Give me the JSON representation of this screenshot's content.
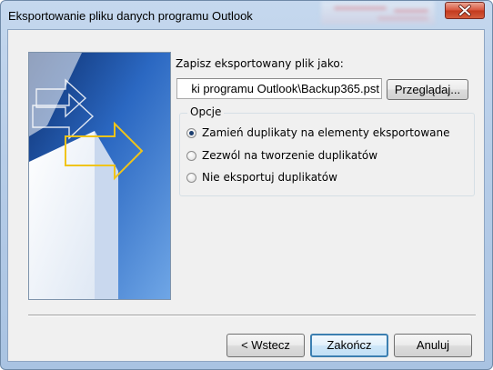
{
  "window": {
    "title": "Eksportowanie pliku danych programu Outlook",
    "close_icon": "close-icon"
  },
  "form": {
    "save_as_label": "Zapisz eksportowany plik jako:",
    "path_value": "ki programu Outlook\\Backup365.pst",
    "browse_label": "Przeglądaj..."
  },
  "options": {
    "group_title": "Opcje",
    "items": [
      {
        "label": "Zamień duplikaty na elementy eksportowane",
        "checked": true
      },
      {
        "label": "Zezwól na tworzenie duplikatów",
        "checked": false
      },
      {
        "label": "Nie eksportuj duplikatów",
        "checked": false
      }
    ]
  },
  "buttons": {
    "back": "< Wstecz",
    "finish": "Zakończ",
    "cancel": "Anuluj"
  },
  "colors": {
    "title_bar": "#b7cde8",
    "close_button": "#c23a1e",
    "wizard_art_blue": "#1f5db8",
    "arrow_accent": "#f0c419",
    "default_button_border": "#3c7fb1"
  }
}
